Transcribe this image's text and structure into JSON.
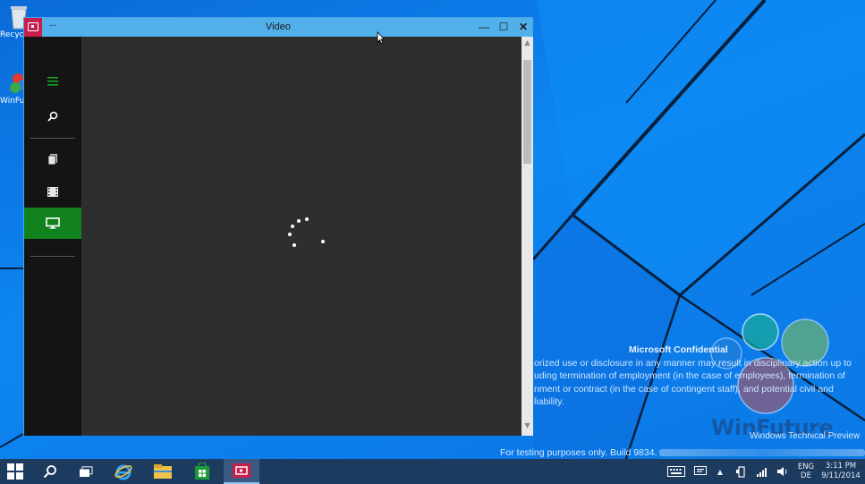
{
  "desktop": {
    "icons": [
      {
        "label": "Recyc",
        "icon": "recycle-bin-icon"
      },
      {
        "label": "WinFu",
        "icon": "winfuture-app-icon"
      }
    ]
  },
  "window": {
    "title": "Video",
    "menu_dots": "···",
    "minimize_label": "—",
    "maximize_label": "☐",
    "close_label": "✕",
    "accent_color": "#12821e",
    "titlebar_color": "#51b0ea",
    "app_icon_color": "#c81e4b"
  },
  "rail": {
    "items": [
      {
        "id": "hamburger",
        "icon": "hamburger-menu-icon",
        "selected": false
      },
      {
        "id": "search",
        "icon": "search-icon",
        "selected": false
      },
      {
        "id": "collection",
        "icon": "collection-icon",
        "selected": false
      },
      {
        "id": "movies",
        "icon": "film-icon",
        "selected": false
      },
      {
        "id": "tv",
        "icon": "tv-monitor-icon",
        "selected": true
      }
    ]
  },
  "watermark": {
    "title": "Microsoft Confidential",
    "lines": [
      "orized use or disclosure in any manner may result in disciplinary action up to",
      "uding termination of employment (in the case of employees), termination of",
      "nment or contract (in the case of contingent staff), and potential civil and",
      "liability."
    ],
    "logo_text": "WinFuture",
    "preview_text": "Windows Technical Preview",
    "build_text": "For testing purposes only. Build 9834."
  },
  "taskbar": {
    "apps": [
      {
        "id": "start",
        "icon": "windows-start-icon"
      },
      {
        "id": "search",
        "icon": "search-icon"
      },
      {
        "id": "taskview",
        "icon": "task-view-icon"
      },
      {
        "id": "ie",
        "icon": "internet-explorer-icon"
      },
      {
        "id": "explorer",
        "icon": "file-explorer-icon"
      },
      {
        "id": "store",
        "icon": "store-icon"
      },
      {
        "id": "video",
        "icon": "video-app-icon",
        "active": true
      }
    ],
    "tray": {
      "chevron": "▲",
      "lang_top": "ENG",
      "lang_bottom": "DE",
      "time": "3:11 PM",
      "date": "9/11/2014"
    }
  }
}
